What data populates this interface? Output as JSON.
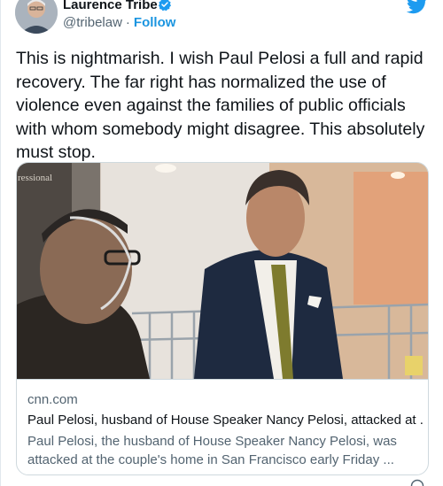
{
  "author": {
    "display_name": "Laurence Tribe",
    "handle": "@tribelaw",
    "separator": "·",
    "follow_label": "Follow",
    "verified_icon": "verified-badge-icon",
    "brand_icon": "twitter-bird-icon"
  },
  "tweet": {
    "text": "This is nightmarish. I wish Paul Pelosi a full and rapid recovery. The far right has normalized the use of violence even against the families of public officials with whom somebody might disagree. This absolutely must stop."
  },
  "card": {
    "domain": "cnn.com",
    "title": "Paul Pelosi, husband of House Speaker Nancy Pelosi, attacked at ...",
    "description": "Paul Pelosi, the husband of House Speaker Nancy Pelosi, was attacked at the couple's home in San Francisco early Friday ...",
    "image_sign_text": "ressional"
  },
  "colors": {
    "accent": "#1b95e0",
    "text_primary": "#0f1419",
    "text_secondary": "#536471",
    "border": "#cfd9de"
  }
}
